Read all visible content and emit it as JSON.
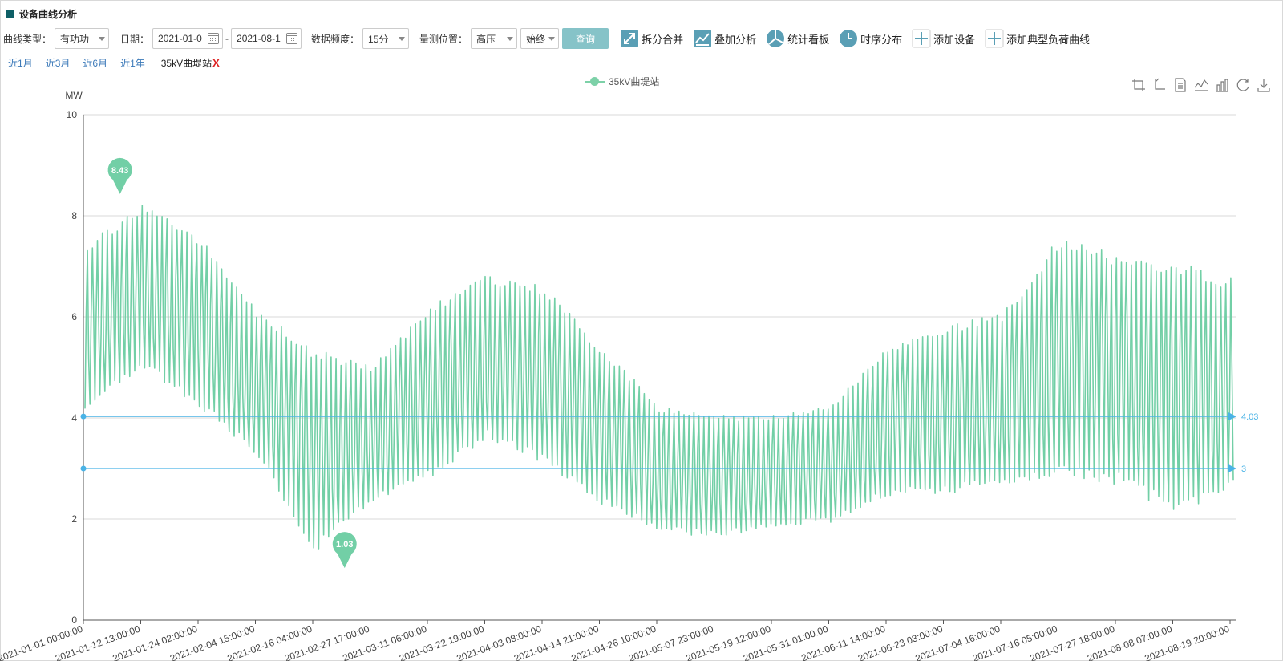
{
  "page": {
    "title": "设备曲线分析"
  },
  "filters": {
    "curve_type_label": "曲线类型：",
    "curve_type_value": "有功功",
    "date_label": "日期：",
    "date_start": "2021-01-0",
    "date_sep": "-",
    "date_end": "2021-08-1",
    "frequency_label": "数据频度：",
    "frequency_value": "15分",
    "position_label": "量测位置：",
    "position_value": "高压",
    "position_sub_value": "始终",
    "query_label": "查询"
  },
  "tools": [
    {
      "label": "拆分合并",
      "icon": "split-merge-icon"
    },
    {
      "label": "叠加分析",
      "icon": "overlay-analysis-icon"
    },
    {
      "label": "统计看板",
      "icon": "pie-stat-icon"
    },
    {
      "label": "时序分布",
      "icon": "clock-icon"
    },
    {
      "label": "添加设备",
      "icon": "plus-icon"
    },
    {
      "label": "添加典型负荷曲线",
      "icon": "plus-icon"
    }
  ],
  "quick_ranges": [
    "近1月",
    "近3月",
    "近6月",
    "近1年"
  ],
  "device_tag": {
    "label": "35kV曲堤站",
    "remove": "X"
  },
  "toolbox_icons": [
    "zoom-icon",
    "zoom-reset-icon",
    "data-view-icon",
    "line-type-icon",
    "bar-type-icon",
    "restore-icon",
    "save-image-icon"
  ],
  "colors": {
    "series": "#72cfa6",
    "markline": "#4ab3e6",
    "accent": "#0e5f66",
    "link": "#3a78b8"
  },
  "chart_data": {
    "type": "line",
    "ylabel": "MW",
    "ylim": [
      0,
      10
    ],
    "yticks": [
      0,
      2,
      4,
      6,
      8,
      10
    ],
    "grid": true,
    "legend": "top-center",
    "x_tick_labels": [
      "2021-01-01 00:00:00",
      "2021-01-12 13:00:00",
      "2021-01-24 02:00:00",
      "2021-02-04 15:00:00",
      "2021-02-16 04:00:00",
      "2021-02-27 17:00:00",
      "2021-03-11 06:00:00",
      "2021-03-22 19:00:00",
      "2021-04-03 08:00:00",
      "2021-04-14 21:00:00",
      "2021-04-26 10:00:00",
      "2021-05-07 23:00:00",
      "2021-05-19 12:00:00",
      "2021-05-31 01:00:00",
      "2021-06-11 14:00:00",
      "2021-06-23 03:00:00",
      "2021-07-04 16:00:00",
      "2021-07-16 05:00:00",
      "2021-07-27 18:00:00",
      "2021-08-08 07:00:00",
      "2021-08-19 20:00:00"
    ],
    "series": [
      {
        "name": "35kV曲堤站",
        "x": [
          "2021-01-01",
          "2021-01-12",
          "2021-01-24",
          "2021-02-04",
          "2021-02-16",
          "2021-02-27",
          "2021-03-11",
          "2021-03-22",
          "2021-04-03",
          "2021-04-14",
          "2021-04-26",
          "2021-05-07",
          "2021-05-19",
          "2021-05-31",
          "2021-06-11",
          "2021-06-23",
          "2021-07-04",
          "2021-07-16",
          "2021-07-27",
          "2021-08-08",
          "2021-08-19"
        ],
        "daily_min": [
          4.0,
          4.8,
          4.0,
          3.1,
          1.1,
          2.2,
          2.6,
          3.4,
          2.9,
          2.1,
          1.6,
          1.5,
          1.7,
          1.8,
          2.3,
          2.3,
          2.5,
          2.6,
          2.4,
          1.8,
          2.3
        ],
        "daily_max": [
          7.6,
          8.4,
          7.8,
          6.3,
          5.6,
          5.2,
          6.4,
          7.0,
          6.8,
          5.6,
          4.4,
          4.2,
          4.2,
          4.4,
          5.6,
          6.0,
          6.3,
          7.9,
          7.5,
          7.4,
          7.0
        ]
      }
    ],
    "mark_points": [
      {
        "label": "8.43",
        "type": "max",
        "x": "2021-01-08",
        "value": 8.43
      },
      {
        "label": "1.03",
        "type": "min",
        "x": "2021-02-22",
        "value": 1.03
      }
    ],
    "mark_lines": [
      {
        "label": "4.03",
        "value": 4.03
      },
      {
        "label": "3",
        "value": 3
      }
    ]
  }
}
